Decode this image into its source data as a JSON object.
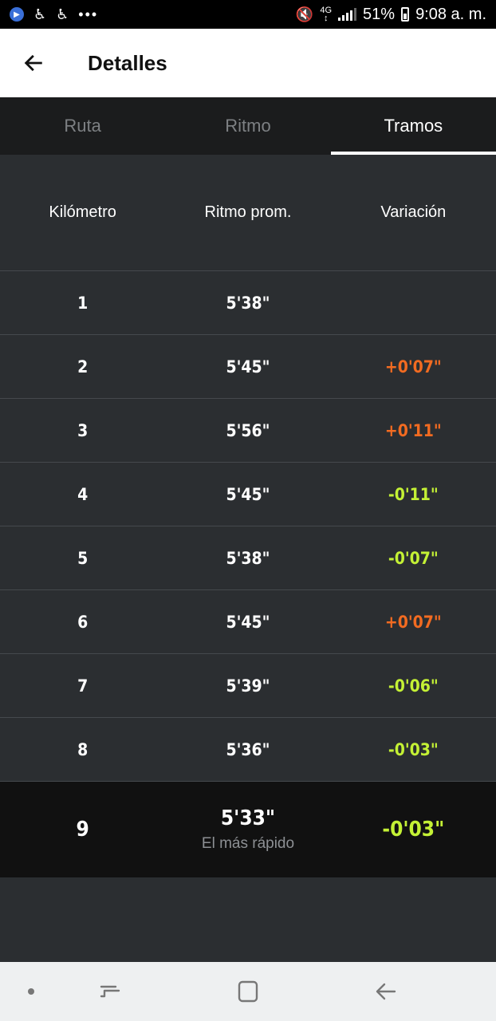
{
  "status_bar": {
    "battery": "51%",
    "time": "9:08 a. m.",
    "network": "4G",
    "dots": "•••",
    "icons": [
      "app-icon",
      "accessibility-icon",
      "accessibility-icon",
      "mute-icon",
      "signal-icon",
      "battery-icon"
    ]
  },
  "header": {
    "title": "Detalles",
    "back_icon": "back-arrow-icon"
  },
  "tabs": [
    {
      "label": "Ruta",
      "active": false
    },
    {
      "label": "Ritmo",
      "active": false
    },
    {
      "label": "Tramos",
      "active": true
    }
  ],
  "table": {
    "columns": [
      "Kilómetro",
      "Ritmo prom.",
      "Variación"
    ],
    "rows": [
      {
        "km": "1",
        "pace": "5'38\"",
        "variation": ""
      },
      {
        "km": "2",
        "pace": "5'45\"",
        "variation": "+0'07\""
      },
      {
        "km": "3",
        "pace": "5'56\"",
        "variation": "+0'11\""
      },
      {
        "km": "4",
        "pace": "5'45\"",
        "variation": "-0'11\""
      },
      {
        "km": "5",
        "pace": "5'38\"",
        "variation": "-0'07\""
      },
      {
        "km": "6",
        "pace": "5'45\"",
        "variation": "+0'07\""
      },
      {
        "km": "7",
        "pace": "5'39\"",
        "variation": "-0'06\""
      },
      {
        "km": "8",
        "pace": "5'36\"",
        "variation": "-0'03\""
      }
    ],
    "fastest": {
      "km": "9",
      "pace": "5'33\"",
      "label": "El más rápido",
      "variation": "-0'03\""
    }
  },
  "colors": {
    "positive_variation": "#f26b21",
    "negative_variation": "#c4f135",
    "background": "#2b2e31"
  },
  "nav_bar": {
    "icons": [
      "dot-icon",
      "recents-icon",
      "home-icon",
      "back-icon"
    ]
  }
}
